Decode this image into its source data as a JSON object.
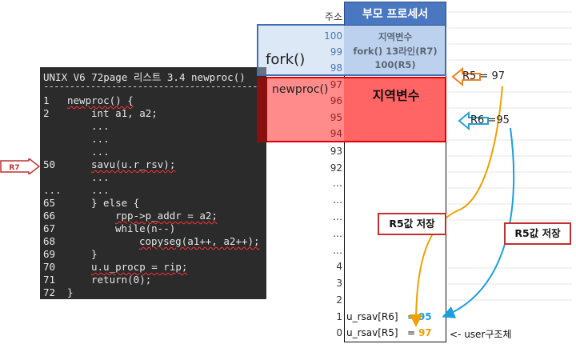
{
  "code": {
    "title": "UNIX V6 72page 리스트 3.4 newproc()",
    "separator": "-----------------------------------------",
    "lines": [
      {
        "no": "1",
        "text": "newproc() {"
      },
      {
        "no": "2",
        "text": "int a1, a2;"
      },
      {
        "no": "",
        "text": "..."
      },
      {
        "no": "",
        "text": "..."
      },
      {
        "no": "",
        "text": "..."
      },
      {
        "no": "50",
        "text": "savu(u.r_rsv);"
      },
      {
        "no": "",
        "text": "..."
      },
      {
        "no": "...",
        "text": "..."
      },
      {
        "no": "65",
        "text": "} else {"
      },
      {
        "no": "66",
        "text": "rpp->p_addr = a2;"
      },
      {
        "no": "67",
        "text": "while(n--)"
      },
      {
        "no": "68",
        "text": "copyseg(a1++, a2++);"
      },
      {
        "no": "69",
        "text": "}"
      },
      {
        "no": "70",
        "text": "u.u_procp = rip;"
      },
      {
        "no": "71",
        "text": "return(0);"
      },
      {
        "no": "72",
        "text": "}"
      }
    ]
  },
  "r7_marker": "R7",
  "memory": {
    "addr_header": "주소",
    "header": "부모 프로세서",
    "frame_lines": [
      "지역변수",
      "fork() 13라인(R7)",
      "100(R5)"
    ],
    "local_label": "지역변수",
    "addresses": [
      "100",
      "99",
      "98",
      "97",
      "96",
      "95",
      "94",
      "93",
      "92",
      "…",
      "…",
      "…",
      "…",
      "…",
      "4",
      "3",
      "2",
      "1",
      "0"
    ],
    "row1_label": "u_rsav[R6]",
    "row0_label": "u_rsav[R5]",
    "equals": "=",
    "row1_value": "95",
    "row0_value": "97",
    "user_struct": "<- user구조체"
  },
  "regions": {
    "fork": "fork()",
    "newproc": "newproc()"
  },
  "registers": {
    "r5": "R5",
    "r5_value": "= 97",
    "r6": "R6",
    "r6_value": "=95"
  },
  "callouts": {
    "a": "R5값 저장",
    "b": "R5값 저장"
  },
  "colors": {
    "header": "#4a78c0",
    "frame": "#c3d6ef",
    "local": "#ff8080",
    "newproc_border": "#e00000",
    "arrow_r5": "#f0a000",
    "arrow_r6": "#1aa0e0"
  }
}
